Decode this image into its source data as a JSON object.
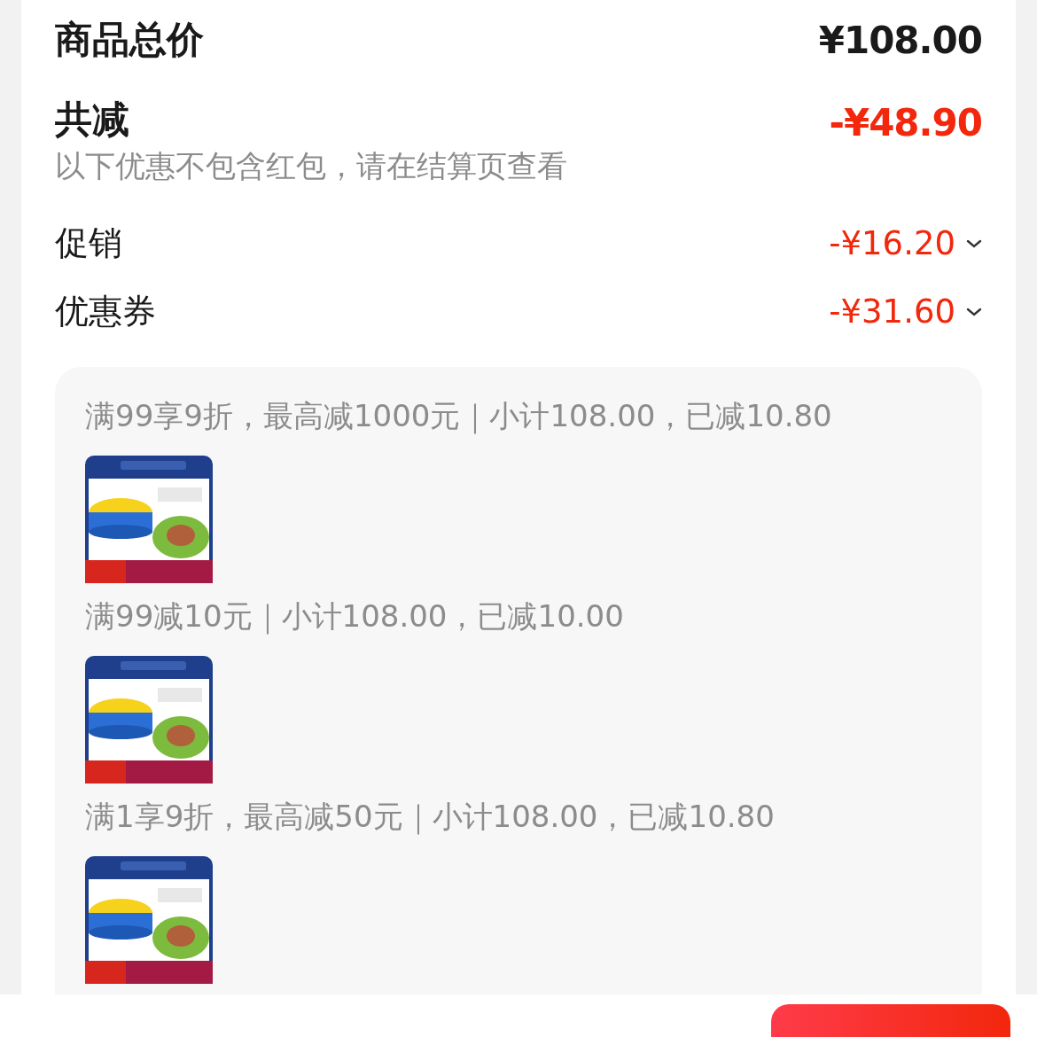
{
  "total": {
    "label": "商品总价",
    "value": "¥108.00"
  },
  "discount": {
    "label": "共减",
    "value": "-¥48.90",
    "note": "以下优惠不包含红包，请在结算页查看"
  },
  "breakdown": [
    {
      "label": "促销",
      "value": "-¥16.20"
    },
    {
      "label": "优惠券",
      "value": "-¥31.60"
    }
  ],
  "promotions": [
    {
      "text": "满99享9折，最高减1000元｜小计108.00，已减10.80"
    },
    {
      "text": "满99减10元｜小计108.00，已减10.00"
    },
    {
      "text": "满1享9折，最高减50元｜小计108.00，已减10.80"
    }
  ]
}
